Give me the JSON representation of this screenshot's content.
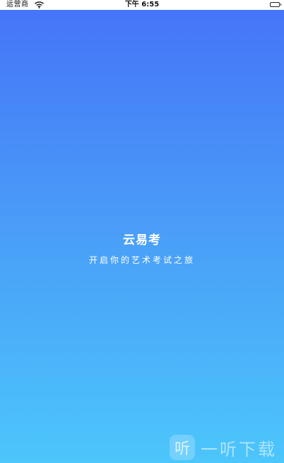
{
  "status_bar": {
    "carrier": "运营商",
    "time": "下午 6:55"
  },
  "splash": {
    "app_name": "云易考",
    "slogan": "开启你的艺术考试之旅",
    "background_top_color": "#4573f8",
    "background_bottom_color": "#4cc6fb"
  },
  "watermark": {
    "logo_glyph": "听",
    "text": "一听下载"
  },
  "icons": {
    "wifi": "wifi-icon",
    "battery": "battery-icon"
  }
}
